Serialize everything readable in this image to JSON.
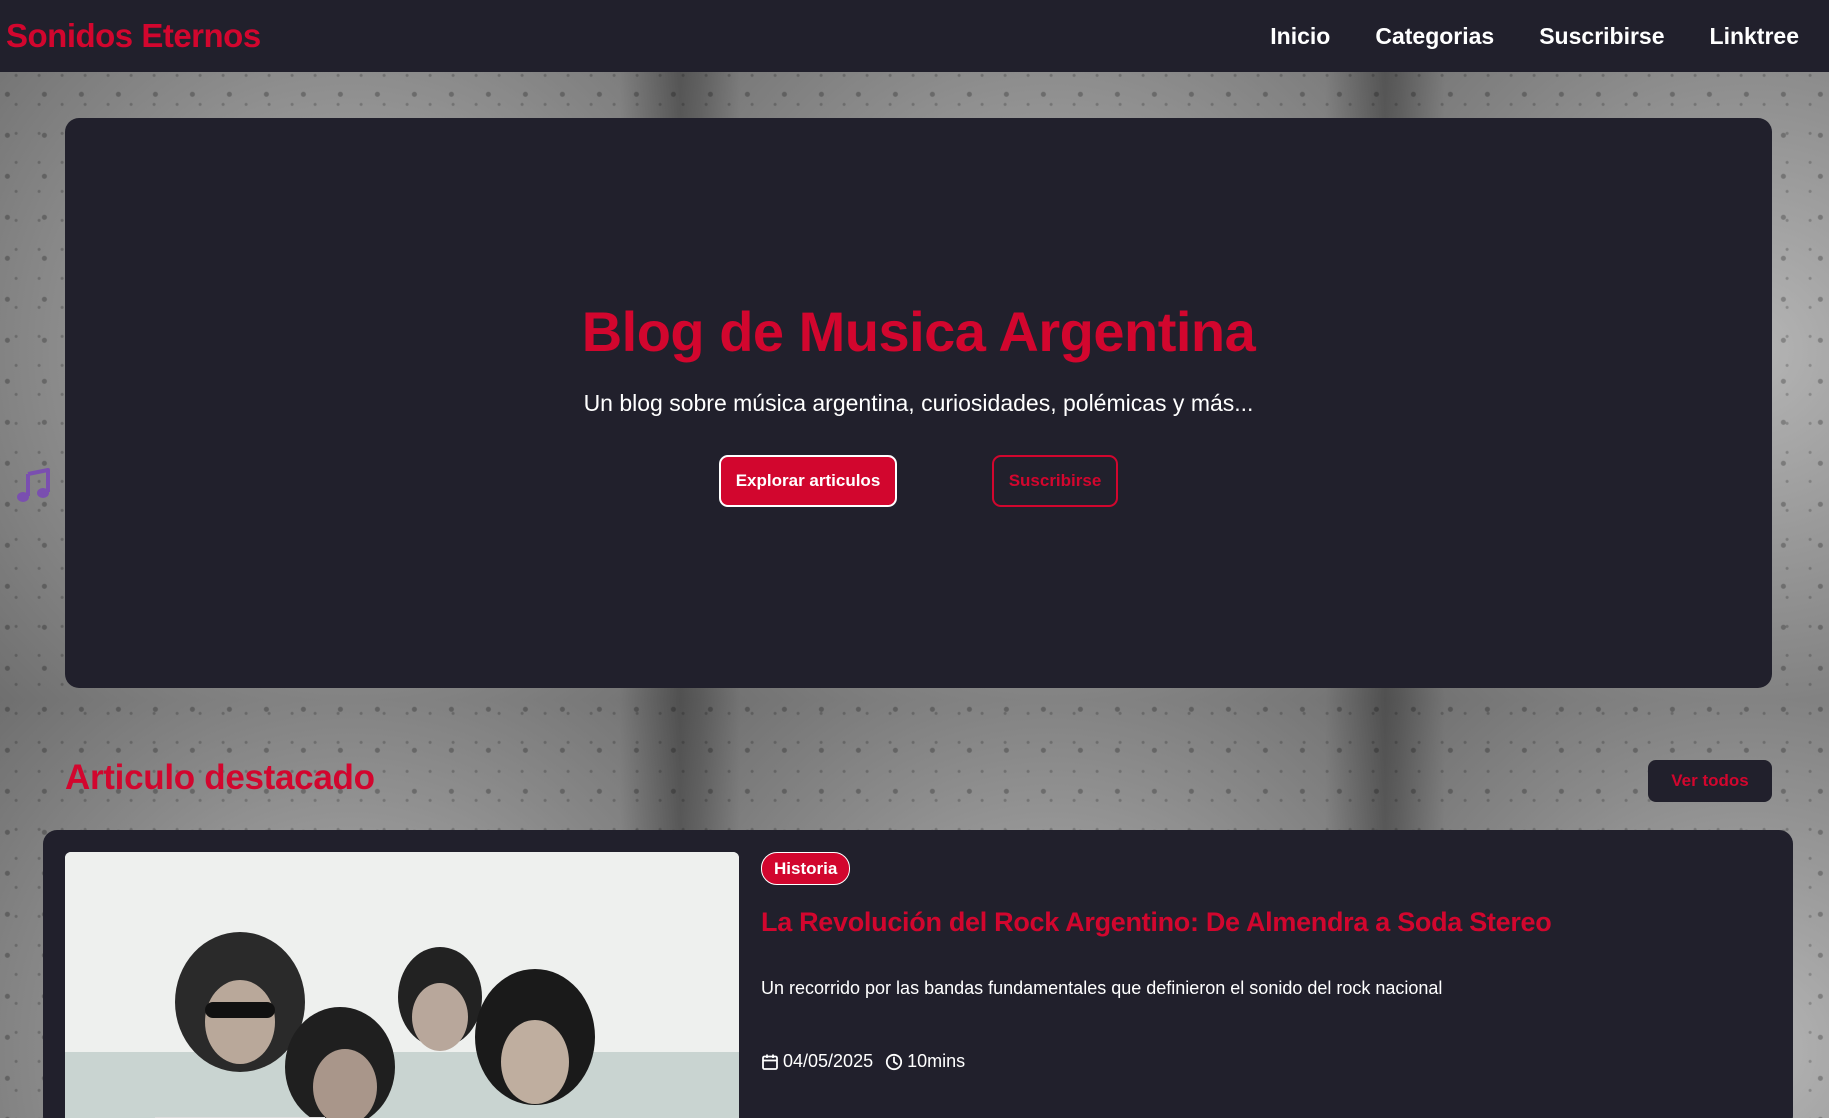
{
  "navbar": {
    "brand": "Sonidos Eternos",
    "links": [
      "Inicio",
      "Categorias",
      "Suscribirse",
      "Linktree"
    ]
  },
  "hero": {
    "title": "Blog de Musica Argentina",
    "subtitle": "Un blog sobre música argentina, curiosidades, polémicas y más...",
    "primary_button": "Explorar articulos",
    "secondary_button": "Suscribirse"
  },
  "featured": {
    "section_title": "Articulo destacado",
    "view_all": "Ver todos",
    "tag": "Historia",
    "title": "La Revolución del Rock Argentino: De Almendra a Soda Stereo",
    "description": "Un recorrido por las bandas fundamentales que definieron el sonido del rock nacional",
    "date": "04/05/2025",
    "read_time": "10mins"
  },
  "icons": {
    "floating": "music-note-icon",
    "date": "calendar-icon",
    "time": "clock-icon"
  },
  "colors": {
    "accent": "#d2062e",
    "surface": "#21202c",
    "music_icon": "#7a4fb0"
  }
}
